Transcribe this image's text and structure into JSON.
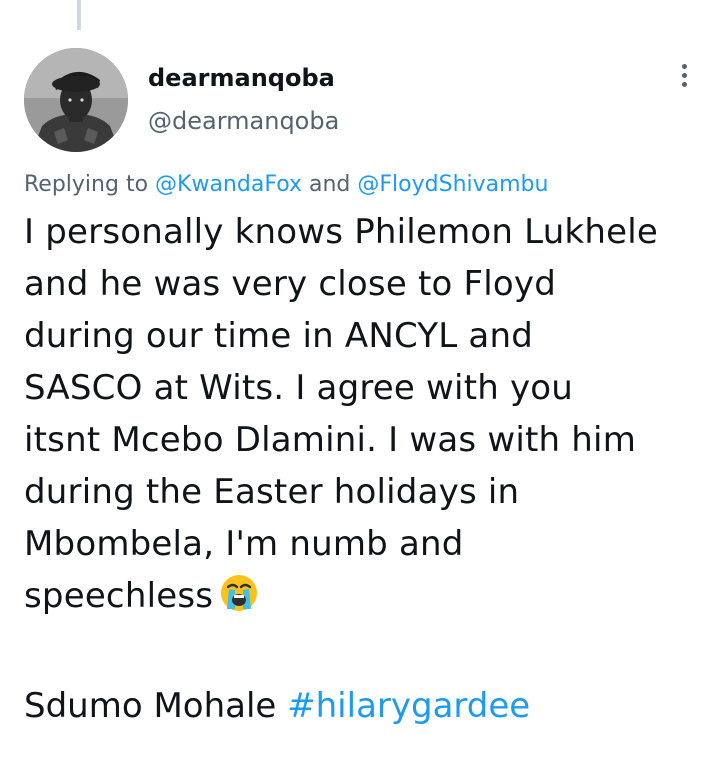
{
  "author": {
    "display_name": "dearmanqoba",
    "handle": "@dearmanqoba"
  },
  "reply": {
    "prefix": "Replying to",
    "mention_1": "@KwandaFox",
    "joiner": "and",
    "mention_2": "@FloydShivambu"
  },
  "tweet": {
    "lines": [
      "I personally knows Philemon Lukhele",
      "and he was very close to Floyd",
      "during our time in ANCYL and",
      "SASCO at Wits. I agree with you",
      "itsnt Mcebo Dlamini. I was with him",
      "during the Easter holidays in",
      "Mbombela, I'm numb and",
      "speechless"
    ],
    "emoji": "loudly-crying-face",
    "signoff_text": "Sdumo Mohale",
    "hashtag": "#hilarygardee"
  },
  "icons": {
    "more": "more-vertical-icon"
  },
  "colors": {
    "link": "#1d9bf0",
    "secondary_text": "#536471",
    "primary_text": "#0f1419",
    "thread_line": "#cfd9de"
  }
}
